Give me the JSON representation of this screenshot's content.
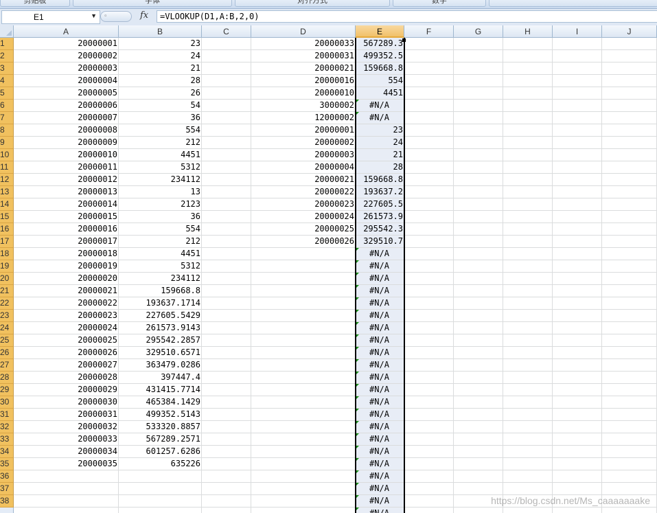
{
  "ribbon": {
    "groups": [
      "剪贴板",
      "字体",
      "对齐方式",
      "数字"
    ]
  },
  "name_box": {
    "value": "E1"
  },
  "formula_bar": {
    "fx_label": "fx",
    "formula": "=VLOOKUP(D1,A:B,2,0)"
  },
  "columns": [
    "A",
    "B",
    "C",
    "D",
    "E",
    "F",
    "G",
    "H",
    "I",
    "J"
  ],
  "selected_column": "E",
  "rows": [
    {
      "n": "1",
      "A": "20000001",
      "B": "23",
      "D": "20000033",
      "E": "567289.3"
    },
    {
      "n": "2",
      "A": "20000002",
      "B": "24",
      "D": "20000031",
      "E": "499352.5"
    },
    {
      "n": "3",
      "A": "20000003",
      "B": "21",
      "D": "20000021",
      "E": "159668.8"
    },
    {
      "n": "4",
      "A": "20000004",
      "B": "28",
      "D": "20000016",
      "E": "554"
    },
    {
      "n": "5",
      "A": "20000005",
      "B": "26",
      "D": "20000010",
      "E": "4451"
    },
    {
      "n": "6",
      "A": "20000006",
      "B": "54",
      "D": "3000002",
      "E": "#N/A"
    },
    {
      "n": "7",
      "A": "20000007",
      "B": "36",
      "D": "12000002",
      "E": "#N/A"
    },
    {
      "n": "8",
      "A": "20000008",
      "B": "554",
      "D": "20000001",
      "E": "23"
    },
    {
      "n": "9",
      "A": "20000009",
      "B": "212",
      "D": "20000002",
      "E": "24"
    },
    {
      "n": "10",
      "A": "20000010",
      "B": "4451",
      "D": "20000003",
      "E": "21"
    },
    {
      "n": "11",
      "A": "20000011",
      "B": "5312",
      "D": "20000004",
      "E": "28"
    },
    {
      "n": "12",
      "A": "20000012",
      "B": "234112",
      "D": "20000021",
      "E": "159668.8"
    },
    {
      "n": "13",
      "A": "20000013",
      "B": "13",
      "D": "20000022",
      "E": "193637.2"
    },
    {
      "n": "14",
      "A": "20000014",
      "B": "2123",
      "D": "20000023",
      "E": "227605.5"
    },
    {
      "n": "15",
      "A": "20000015",
      "B": "36",
      "D": "20000024",
      "E": "261573.9"
    },
    {
      "n": "16",
      "A": "20000016",
      "B": "554",
      "D": "20000025",
      "E": "295542.3"
    },
    {
      "n": "17",
      "A": "20000017",
      "B": "212",
      "D": "20000026",
      "E": "329510.7"
    },
    {
      "n": "18",
      "A": "20000018",
      "B": "4451",
      "D": "",
      "E": "#N/A"
    },
    {
      "n": "19",
      "A": "20000019",
      "B": "5312",
      "D": "",
      "E": "#N/A"
    },
    {
      "n": "20",
      "A": "20000020",
      "B": "234112",
      "D": "",
      "E": "#N/A"
    },
    {
      "n": "21",
      "A": "20000021",
      "B": "159668.8",
      "D": "",
      "E": "#N/A"
    },
    {
      "n": "22",
      "A": "20000022",
      "B": "193637.1714",
      "D": "",
      "E": "#N/A"
    },
    {
      "n": "23",
      "A": "20000023",
      "B": "227605.5429",
      "D": "",
      "E": "#N/A"
    },
    {
      "n": "24",
      "A": "20000024",
      "B": "261573.9143",
      "D": "",
      "E": "#N/A"
    },
    {
      "n": "25",
      "A": "20000025",
      "B": "295542.2857",
      "D": "",
      "E": "#N/A"
    },
    {
      "n": "26",
      "A": "20000026",
      "B": "329510.6571",
      "D": "",
      "E": "#N/A"
    },
    {
      "n": "27",
      "A": "20000027",
      "B": "363479.0286",
      "D": "",
      "E": "#N/A"
    },
    {
      "n": "28",
      "A": "20000028",
      "B": "397447.4",
      "D": "",
      "E": "#N/A"
    },
    {
      "n": "29",
      "A": "20000029",
      "B": "431415.7714",
      "D": "",
      "E": "#N/A"
    },
    {
      "n": "30",
      "A": "20000030",
      "B": "465384.1429",
      "D": "",
      "E": "#N/A"
    },
    {
      "n": "31",
      "A": "20000031",
      "B": "499352.5143",
      "D": "",
      "E": "#N/A"
    },
    {
      "n": "32",
      "A": "20000032",
      "B": "533320.8857",
      "D": "",
      "E": "#N/A"
    },
    {
      "n": "33",
      "A": "20000033",
      "B": "567289.2571",
      "D": "",
      "E": "#N/A"
    },
    {
      "n": "34",
      "A": "20000034",
      "B": "601257.6286",
      "D": "",
      "E": "#N/A"
    },
    {
      "n": "35",
      "A": "20000035",
      "B": "635226",
      "D": "",
      "E": "#N/A"
    },
    {
      "n": "36",
      "A": "",
      "B": "",
      "D": "",
      "E": "#N/A"
    },
    {
      "n": "37",
      "A": "",
      "B": "",
      "D": "",
      "E": "#N/A"
    },
    {
      "n": "38",
      "A": "",
      "B": "",
      "D": "",
      "E": "#N/A"
    },
    {
      "n": "",
      "A": "",
      "B": "",
      "D": "",
      "E": "#N/A"
    }
  ],
  "watermark": "https://blog.csdn.net/Ms_caaaaaaake",
  "colors": {
    "header_selected": "#f1c15f",
    "selection_col": "#e8edf6",
    "error_flag": "#1a8f1a"
  }
}
